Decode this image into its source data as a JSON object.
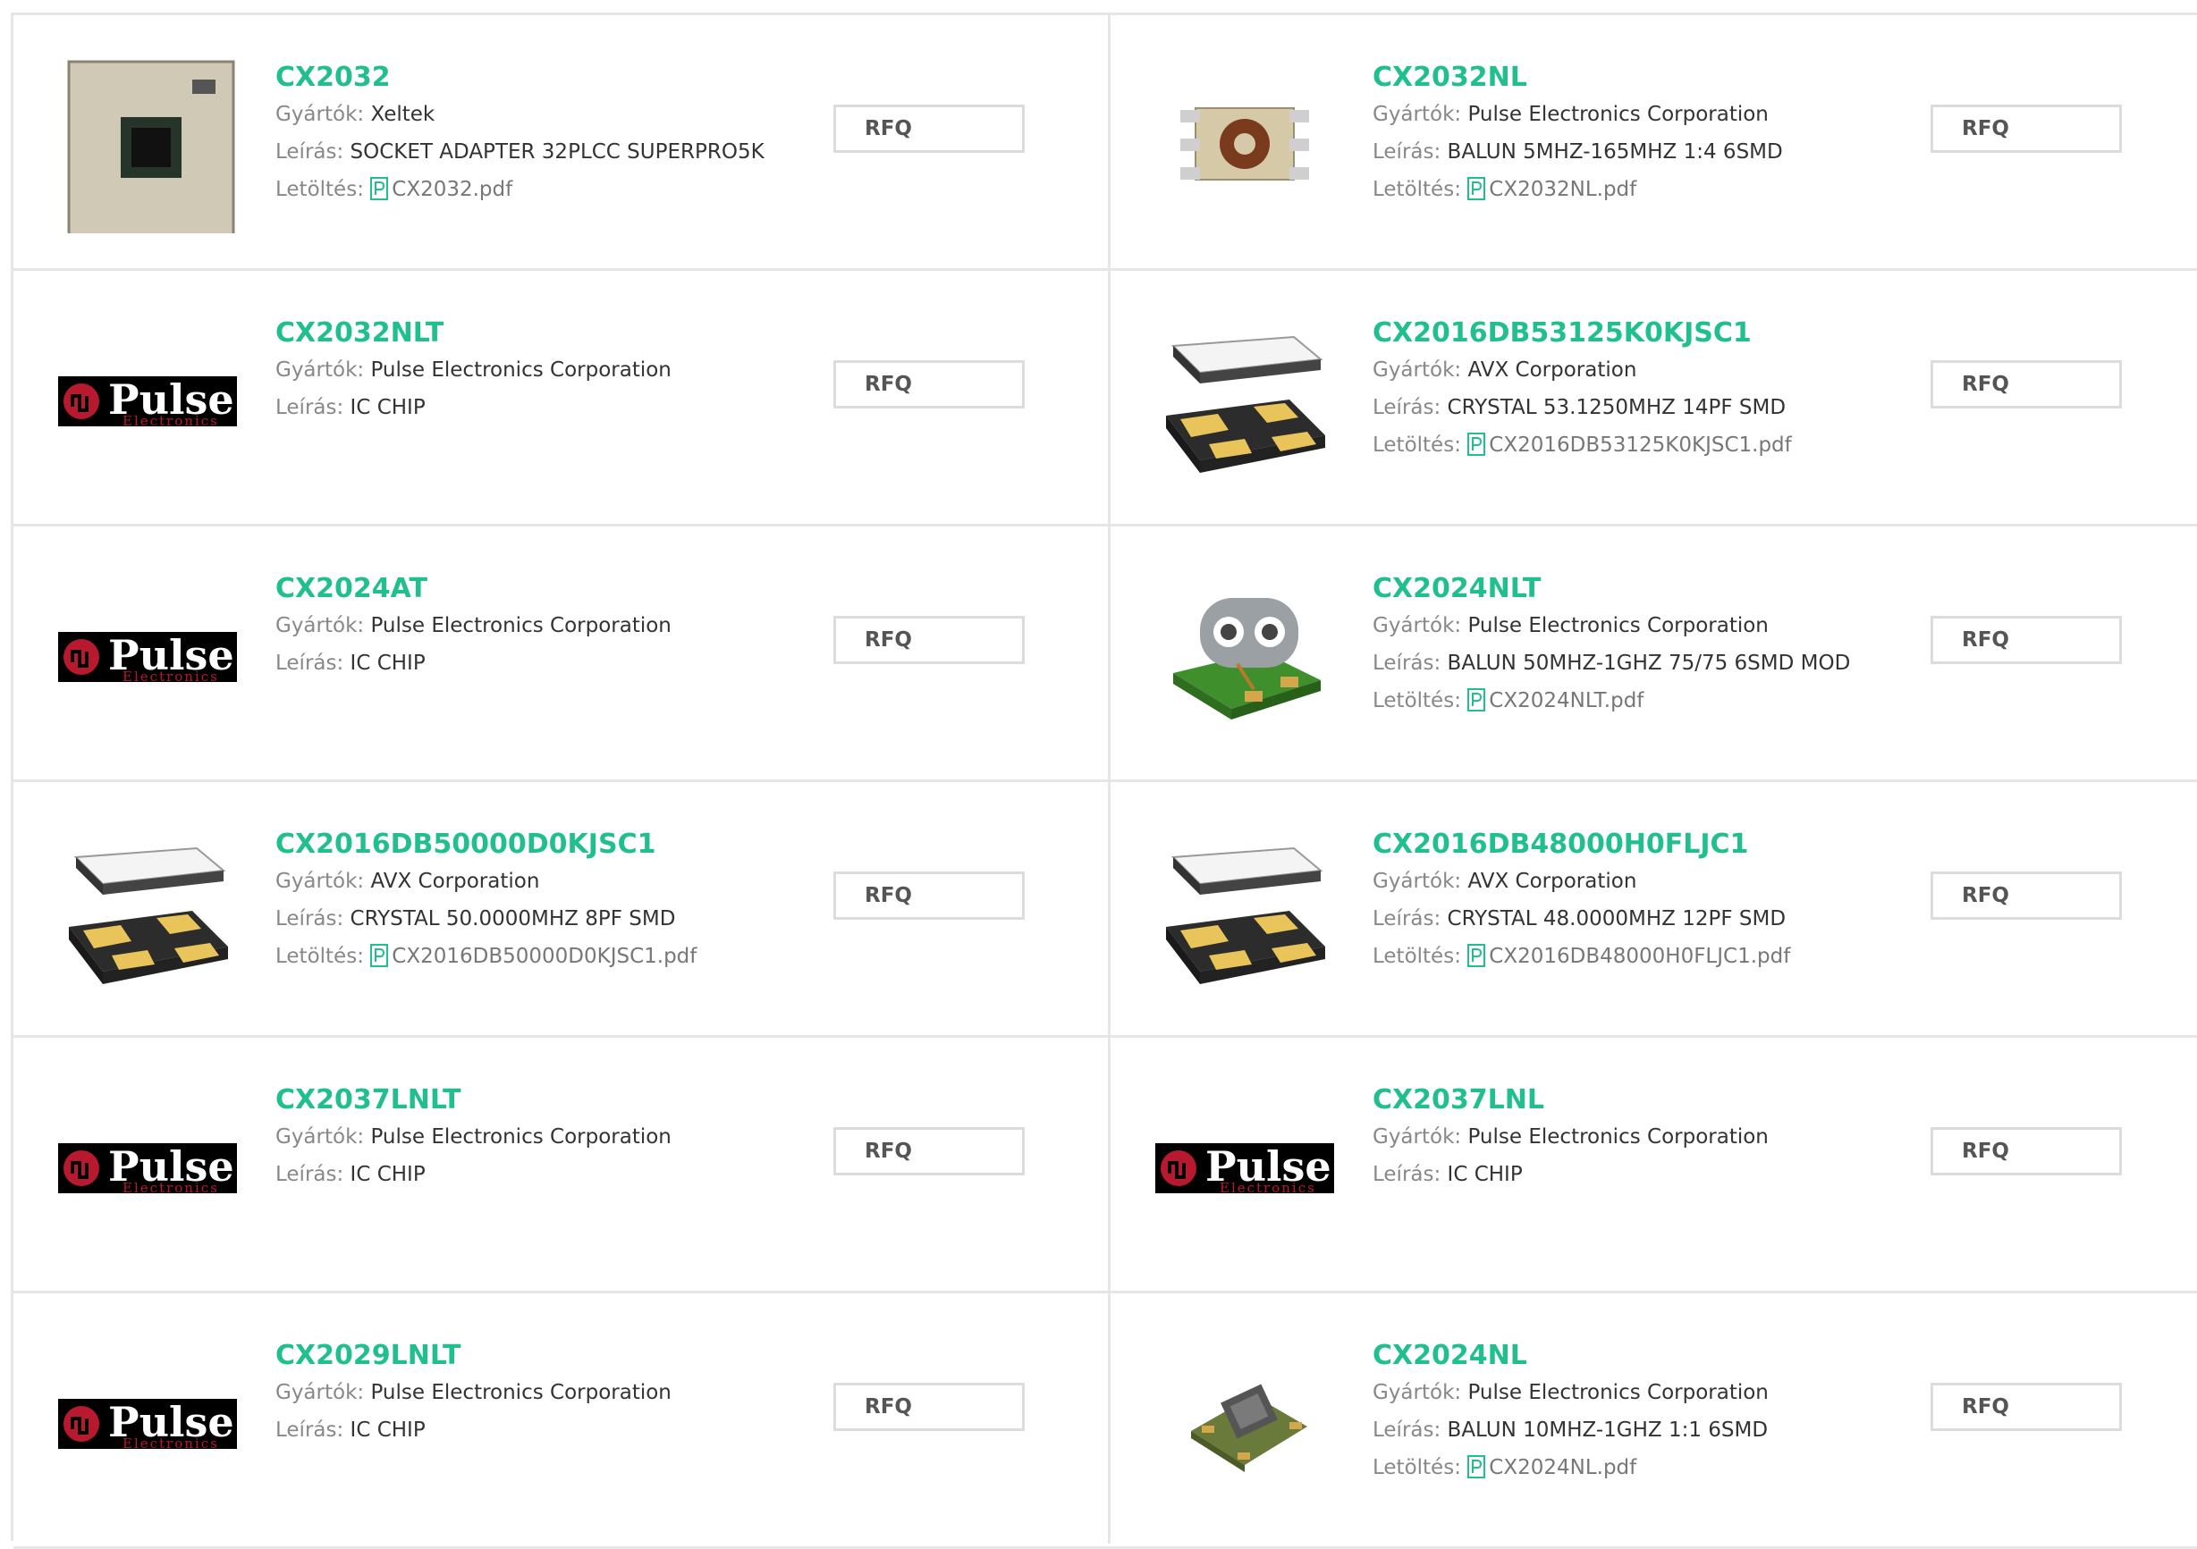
{
  "labels": {
    "manufacturer": "Gyártók:",
    "description": "Leírás:",
    "download": "Letöltés:",
    "rfq": "RFQ"
  },
  "colors": {
    "accent": "#22bf8e",
    "border": "#e6e6e6"
  },
  "products": [
    {
      "name": "CX2032",
      "manufacturer": "Xeltek",
      "description": "SOCKET ADAPTER 32PLCC SUPERPRO5K",
      "pdf": "CX2032.pdf",
      "image": "socket-adapter-board"
    },
    {
      "name": "CX2032NL",
      "manufacturer": "Pulse Electronics Corporation",
      "description": "BALUN 5MHZ-165MHZ 1:4 6SMD",
      "pdf": "CX2032NL.pdf",
      "image": "balun-toroid"
    },
    {
      "name": "CX2032NLT",
      "manufacturer": "Pulse Electronics Corporation",
      "description": "IC CHIP",
      "pdf": null,
      "image": "pulse-logo"
    },
    {
      "name": "CX2016DB53125K0KJSC1",
      "manufacturer": "AVX Corporation",
      "description": "CRYSTAL 53.1250MHZ 14PF SMD",
      "pdf": "CX2016DB53125K0KJSC1.pdf",
      "image": "crystal-smd"
    },
    {
      "name": "CX2024AT",
      "manufacturer": "Pulse Electronics Corporation",
      "description": "IC CHIP",
      "pdf": null,
      "image": "pulse-logo"
    },
    {
      "name": "CX2024NLT",
      "manufacturer": "Pulse Electronics Corporation",
      "description": "BALUN 50MHZ-1GHZ 75/75 6SMD MOD",
      "pdf": "CX2024NLT.pdf",
      "image": "balun-binocular"
    },
    {
      "name": "CX2016DB50000D0KJSC1",
      "manufacturer": "AVX Corporation",
      "description": "CRYSTAL 50.0000MHZ 8PF SMD",
      "pdf": "CX2016DB50000D0KJSC1.pdf",
      "image": "crystal-smd"
    },
    {
      "name": "CX2016DB48000H0FLJC1",
      "manufacturer": "AVX Corporation",
      "description": "CRYSTAL 48.0000MHZ 12PF SMD",
      "pdf": "CX2016DB48000H0FLJC1.pdf",
      "image": "crystal-smd"
    },
    {
      "name": "CX2037LNLT",
      "manufacturer": "Pulse Electronics Corporation",
      "description": "IC CHIP",
      "pdf": null,
      "image": "pulse-logo"
    },
    {
      "name": "CX2037LNL",
      "manufacturer": "Pulse Electronics Corporation",
      "description": "IC CHIP",
      "pdf": null,
      "image": "pulse-logo"
    },
    {
      "name": "CX2029LNLT",
      "manufacturer": "Pulse Electronics Corporation",
      "description": "IC CHIP",
      "pdf": null,
      "image": "pulse-logo"
    },
    {
      "name": "CX2024NL",
      "manufacturer": "Pulse Electronics Corporation",
      "description": "BALUN 10MHZ-1GHZ 1:1 6SMD",
      "pdf": "CX2024NL.pdf",
      "image": "balun-smd-green"
    }
  ],
  "pulse_logo": {
    "word": "Pulse",
    "sub": "Electronics"
  }
}
